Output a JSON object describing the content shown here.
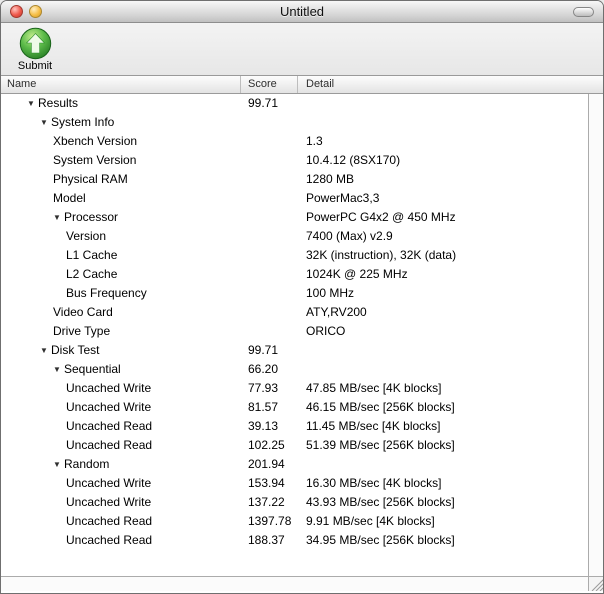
{
  "window": {
    "title": "Untitled"
  },
  "toolbar": {
    "items": [
      {
        "label": "Submit",
        "icon": "green-sphere-up-arrow"
      }
    ]
  },
  "table": {
    "columns": [
      {
        "id": "name",
        "label": "Name"
      },
      {
        "id": "score",
        "label": "Score"
      },
      {
        "id": "detail",
        "label": "Detail"
      }
    ],
    "rows": [
      {
        "name": "Results",
        "score": "99.71",
        "detail": "",
        "level": 0,
        "expandable": true
      },
      {
        "name": "System Info",
        "score": "",
        "detail": "",
        "level": 1,
        "expandable": true
      },
      {
        "name": "Xbench Version",
        "score": "",
        "detail": "1.3",
        "level": 2,
        "expandable": false
      },
      {
        "name": "System Version",
        "score": "",
        "detail": "10.4.12 (8SX170)",
        "level": 2,
        "expandable": false
      },
      {
        "name": "Physical RAM",
        "score": "",
        "detail": "1280 MB",
        "level": 2,
        "expandable": false
      },
      {
        "name": "Model",
        "score": "",
        "detail": "PowerMac3,3",
        "level": 2,
        "expandable": false
      },
      {
        "name": "Processor",
        "score": "",
        "detail": "PowerPC G4x2 @ 450 MHz",
        "level": 2,
        "expandable": true
      },
      {
        "name": "Version",
        "score": "",
        "detail": "7400 (Max) v2.9",
        "level": 3,
        "expandable": false
      },
      {
        "name": "L1 Cache",
        "score": "",
        "detail": "32K (instruction), 32K (data)",
        "level": 3,
        "expandable": false
      },
      {
        "name": "L2 Cache",
        "score": "",
        "detail": "1024K @ 225 MHz",
        "level": 3,
        "expandable": false
      },
      {
        "name": "Bus Frequency",
        "score": "",
        "detail": "100 MHz",
        "level": 3,
        "expandable": false
      },
      {
        "name": "Video Card",
        "score": "",
        "detail": "ATY,RV200",
        "level": 2,
        "expandable": false
      },
      {
        "name": "Drive Type",
        "score": "",
        "detail": "ORICO",
        "level": 2,
        "expandable": false
      },
      {
        "name": "Disk Test",
        "score": "99.71",
        "detail": "",
        "level": 1,
        "expandable": true
      },
      {
        "name": "Sequential",
        "score": "66.20",
        "detail": "",
        "level": 2,
        "expandable": true
      },
      {
        "name": "Uncached Write",
        "score": "77.93",
        "detail": "47.85 MB/sec [4K blocks]",
        "level": 3,
        "expandable": false
      },
      {
        "name": "Uncached Write",
        "score": "81.57",
        "detail": "46.15 MB/sec [256K blocks]",
        "level": 3,
        "expandable": false
      },
      {
        "name": "Uncached Read",
        "score": "39.13",
        "detail": "11.45 MB/sec [4K blocks]",
        "level": 3,
        "expandable": false
      },
      {
        "name": "Uncached Read",
        "score": "102.25",
        "detail": "51.39 MB/sec [256K blocks]",
        "level": 3,
        "expandable": false
      },
      {
        "name": "Random",
        "score": "201.94",
        "detail": "",
        "level": 2,
        "expandable": true
      },
      {
        "name": "Uncached Write",
        "score": "153.94",
        "detail": "16.30 MB/sec [4K blocks]",
        "level": 3,
        "expandable": false
      },
      {
        "name": "Uncached Write",
        "score": "137.22",
        "detail": "43.93 MB/sec [256K blocks]",
        "level": 3,
        "expandable": false
      },
      {
        "name": "Uncached Read",
        "score": "1397.78",
        "detail": "9.91 MB/sec [4K blocks]",
        "level": 3,
        "expandable": false
      },
      {
        "name": "Uncached Read",
        "score": "188.37",
        "detail": "34.95 MB/sec [256K blocks]",
        "level": 3,
        "expandable": false
      }
    ]
  },
  "icons": {
    "close": "red-close-circle",
    "minimize": "yellow-minimize-circle",
    "toolbar_toggle": "pill-widget",
    "disclosure": "triangle-down",
    "resize": "diagonal-grip-lines"
  },
  "colors": {
    "close_button": "#ef584b",
    "minimize_button": "#f6be46",
    "submit_icon_green": "#44a238",
    "titlebar_top": "#f7f7f7",
    "titlebar_bottom": "#c0c0c0"
  }
}
